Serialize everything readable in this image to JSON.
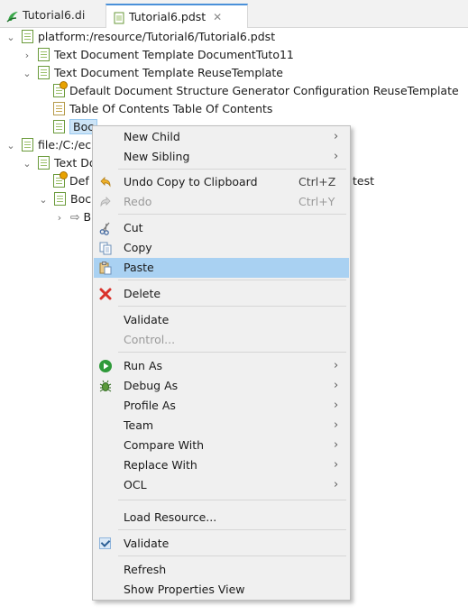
{
  "tabs": [
    {
      "label": "Tutorial6.di",
      "icon": "papyrus-diagram-icon"
    },
    {
      "label": "Tutorial6.pdst",
      "icon": "pdst-editor-icon",
      "close": "✕"
    }
  ],
  "tree": {
    "root1": "platform:/resource/Tutorial6/Tutorial6.pdst",
    "item1": "Text Document Template DocumentTuto11",
    "item2": "Text Document Template ReuseTemplate",
    "item2_child1": "Default Document Structure Generator Configuration ReuseTemplate",
    "item2_child2": "Table Of Contents Table Of Contents",
    "item2_child3": "Boc",
    "root2": "file:/C:/ecl",
    "r2_item1": "Text Do",
    "r2_item1_child1": "Def",
    "r2_item1_child1_tail": "test",
    "r2_item2": "Boc",
    "r2_item2_child1": "B"
  },
  "menu": {
    "new_child": "New Child",
    "new_sibling": "New Sibling",
    "undo": "Undo Copy to Clipboard",
    "undo_shortcut": "Ctrl+Z",
    "redo": "Redo",
    "redo_shortcut": "Ctrl+Y",
    "cut": "Cut",
    "copy": "Copy",
    "paste": "Paste",
    "delete": "Delete",
    "validate": "Validate",
    "control": "Control...",
    "run_as": "Run As",
    "debug_as": "Debug As",
    "profile_as": "Profile As",
    "team": "Team",
    "compare_with": "Compare With",
    "replace_with": "Replace With",
    "ocl": "OCL",
    "load_resource": "Load Resource...",
    "validate_toggle": "Validate",
    "refresh": "Refresh",
    "show_properties": "Show Properties View"
  },
  "colors": {
    "highlight": "#a9d1f2",
    "tab_accent": "#4a90d9",
    "delete_red": "#d9322b",
    "run_green": "#2f9a3a"
  }
}
